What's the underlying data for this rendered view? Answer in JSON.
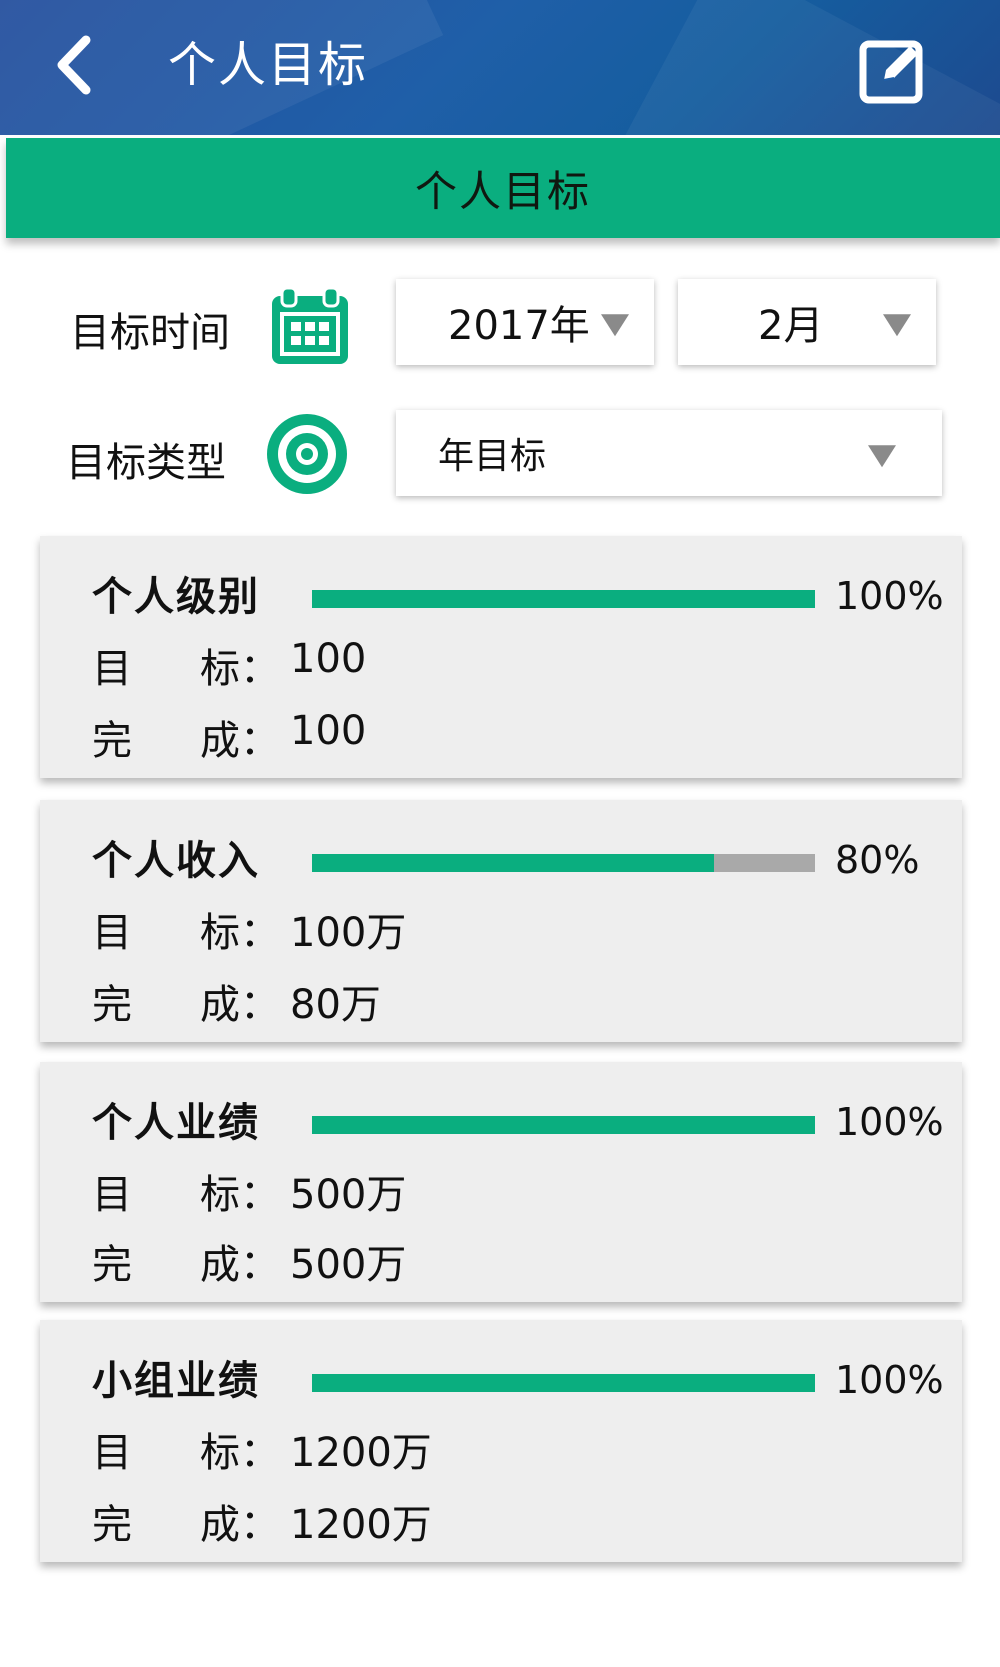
{
  "header": {
    "title": "个人目标",
    "back_icon": "chevron-left-icon",
    "edit_icon": "edit-icon"
  },
  "banner": {
    "label": "个人目标"
  },
  "filters": {
    "time_label": "目标时间",
    "time_icon": "calendar-icon",
    "year_value": "2017年",
    "month_value": "2月",
    "type_label": "目标类型",
    "type_icon": "target-icon",
    "type_value": "年目标"
  },
  "colors": {
    "accent": "#0aae7f",
    "header": "#1f5fa8",
    "track": "#a9a9a9",
    "card": "#eeeeee"
  },
  "cards": [
    {
      "title": "个人级别",
      "percent_text": "100%",
      "progress": 1.0,
      "target_label_a": "目",
      "target_label_b": "标：",
      "target_value": "100",
      "done_label_a": "完",
      "done_label_b": "成：",
      "done_value": "100"
    },
    {
      "title": "个人收入",
      "percent_text": "80%",
      "progress": 0.8,
      "target_label_a": "目",
      "target_label_b": "标：",
      "target_value": "100万",
      "done_label_a": "完",
      "done_label_b": "成：",
      "done_value": "80万"
    },
    {
      "title": "个人业绩",
      "percent_text": "100%",
      "progress": 1.0,
      "target_label_a": "目",
      "target_label_b": "标：",
      "target_value": "500万",
      "done_label_a": "完",
      "done_label_b": "成：",
      "done_value": "500万"
    },
    {
      "title": "小组业绩",
      "percent_text": "100%",
      "progress": 1.0,
      "target_label_a": "目",
      "target_label_b": "标：",
      "target_value": "1200万",
      "done_label_a": "完",
      "done_label_b": "成：",
      "done_value": "1200万"
    }
  ]
}
